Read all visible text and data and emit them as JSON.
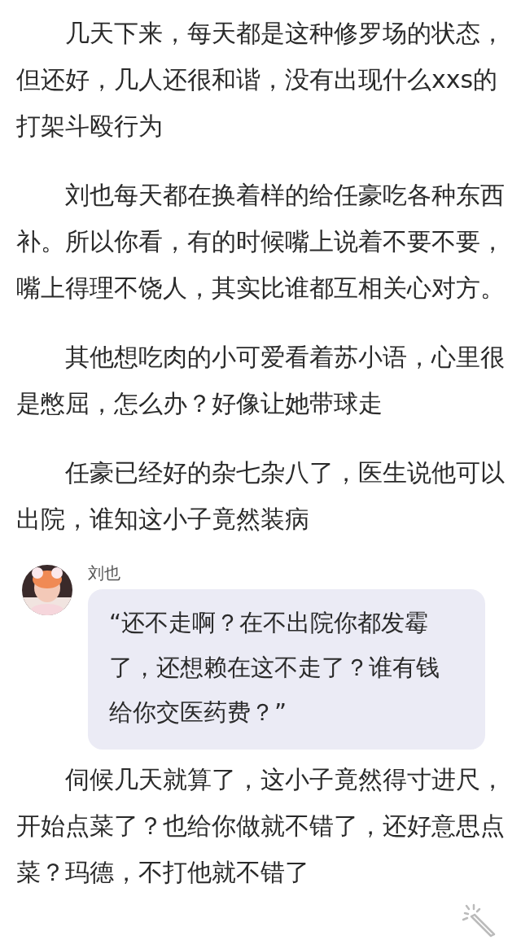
{
  "paragraphs_before": [
    "几天下来，每天都是这种修罗场的状态，但还好，几人还很和谐，没有出现什么xxs的打架斗殴行为",
    "刘也每天都在换着样的给任豪吃各种东西补。所以你看，有的时候嘴上说着不要不要，嘴上得理不饶人，其实比谁都互相关心对方。",
    "其他想吃肉的小可爱看着苏小语，心里很是憋屈，怎么办？好像让她带球走",
    "任豪已经好的杂七杂八了，医生说他可以出院，谁知这小子竟然装病"
  ],
  "dialogue": {
    "speaker": "刘也",
    "text": "“还不走啊？在不出院你都发霉了，还想赖在这不走了？谁有钱给你交医药费？”"
  },
  "paragraphs_after": [
    "伺候几天就算了，这小子竟然得寸进尺，开始点菜了？也给你做就不错了，还好意思点菜？玛德，不打他就不错了"
  ]
}
